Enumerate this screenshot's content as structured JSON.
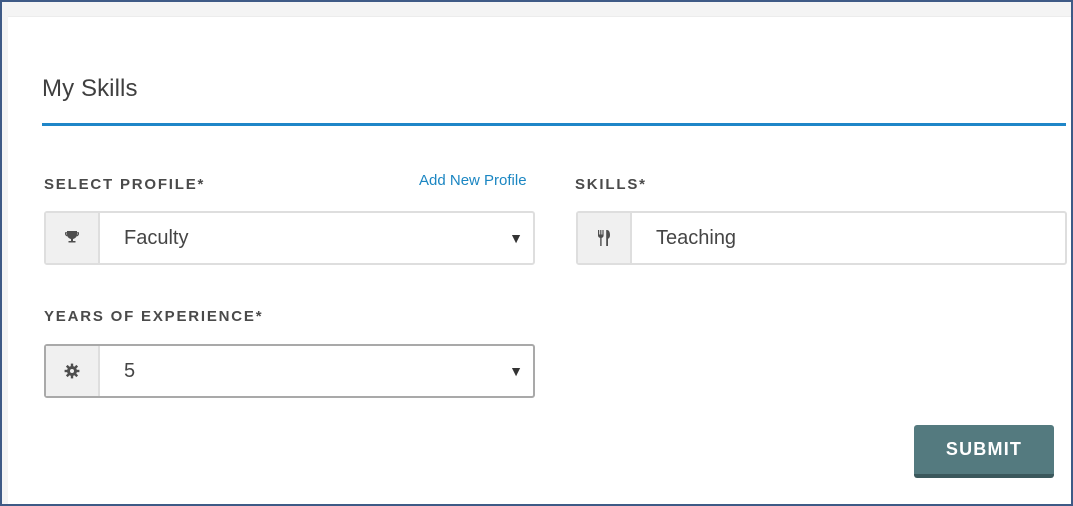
{
  "page": {
    "title": "My Skills"
  },
  "form": {
    "profile": {
      "label": "SELECT PROFILE*",
      "add_link": "Add New Profile",
      "value": "Faculty",
      "icon": "trophy-icon"
    },
    "skills": {
      "label": "SKILLS*",
      "value": "Teaching",
      "icon": "fork-knife-icon"
    },
    "experience": {
      "label": "YEARS OF EXPERIENCE*",
      "value": "5",
      "icon": "gear-icon"
    },
    "submit_label": "SUBMIT"
  },
  "colors": {
    "accent": "#1f86c8",
    "link": "#1b86c2",
    "submit_bg": "#547a7f",
    "frame_border": "#3e5a86"
  }
}
